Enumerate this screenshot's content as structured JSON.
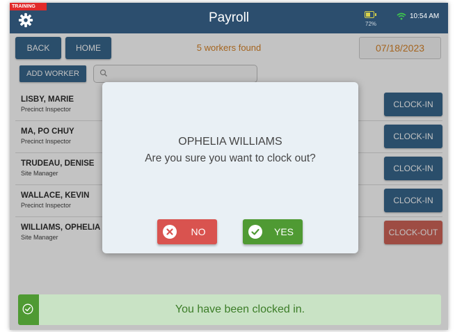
{
  "header": {
    "training_badge": "TRAINING",
    "title": "Payroll",
    "battery_percent": "72%",
    "battery_level": 0.72,
    "time": "10:54 AM",
    "icons": [
      "gear-icon",
      "battery-icon",
      "wifi-icon"
    ]
  },
  "toolbar": {
    "back_label": "BACK",
    "home_label": "HOME",
    "workers_found": "5 workers found",
    "date": "07/18/2023",
    "add_worker_label": "ADD WORKER",
    "search_placeholder": ""
  },
  "workers": [
    {
      "name": "LISBY, MARIE",
      "role": "Precinct Inspector",
      "action": "CLOCK-IN"
    },
    {
      "name": "MA, PO CHUY",
      "role": "Precinct Inspector",
      "action": "CLOCK-IN"
    },
    {
      "name": "TRUDEAU, DENISE",
      "role": "Site Manager",
      "action": "CLOCK-IN"
    },
    {
      "name": "WALLACE, KEVIN",
      "role": "Precinct Inspector",
      "action": "CLOCK-IN"
    },
    {
      "name": "WILLIAMS, OPHELIA",
      "role": "Site Manager",
      "action": "CLOCK-OUT"
    }
  ],
  "dialog": {
    "worker_name": "OPHELIA WILLIAMS",
    "message": "Are you sure you want to clock out?",
    "no_label": "NO",
    "yes_label": "YES"
  },
  "toast": {
    "message": "You have been clocked in."
  },
  "colors": {
    "header_bg": "#2c4e6e",
    "primary_button": "#2c5e86",
    "clock_out": "#cc5a4e",
    "accent_orange": "#d47c1c",
    "success_green": "#4f9a33",
    "danger_red": "#d9534f"
  }
}
